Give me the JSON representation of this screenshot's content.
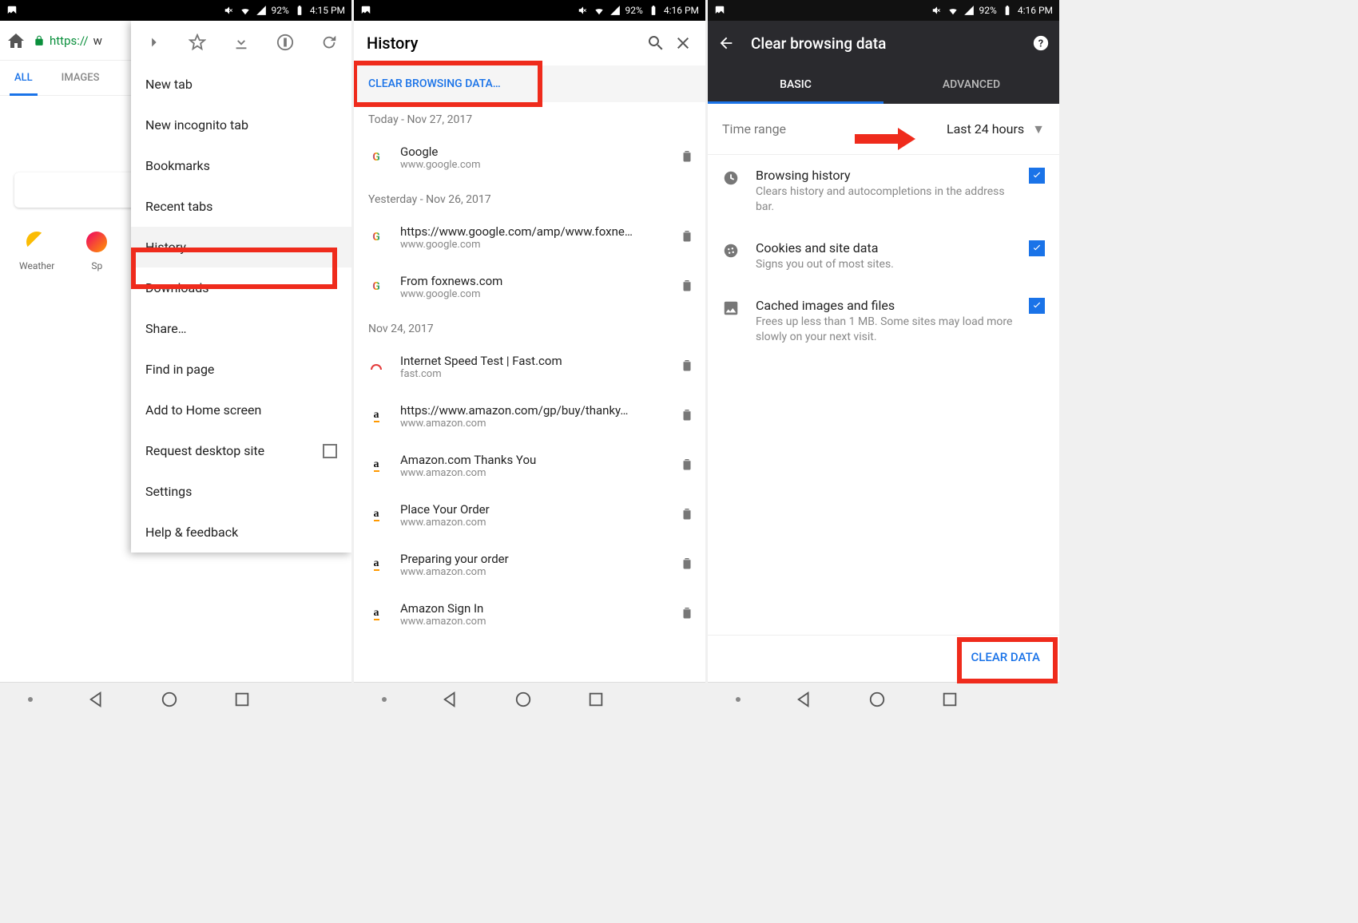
{
  "status": {
    "battery_text": "92%",
    "time1": "4:15 PM",
    "time2": "4:16 PM",
    "time3": "4:16 PM"
  },
  "screen1": {
    "url_prefix": "https://",
    "url_rest": "w",
    "tabs": {
      "all": "ALL",
      "images": "IMAGES"
    },
    "shortcut_weather": "Weather",
    "shortcut_sports": "Sp",
    "menu": {
      "new_tab": "New tab",
      "new_incognito": "New incognito tab",
      "bookmarks": "Bookmarks",
      "recent_tabs": "Recent tabs",
      "history": "History",
      "downloads": "Downloads",
      "share": "Share…",
      "find": "Find in page",
      "add_home": "Add to Home screen",
      "desktop": "Request desktop site",
      "settings": "Settings",
      "help": "Help & feedback"
    }
  },
  "screen2": {
    "title": "History",
    "clear_btn": "CLEAR BROWSING DATA…",
    "sections": [
      {
        "date": "Today - Nov 27, 2017",
        "entries": [
          {
            "title": "Google",
            "sub": "www.google.com",
            "fav": "G"
          }
        ]
      },
      {
        "date": "Yesterday - Nov 26, 2017",
        "entries": [
          {
            "title": "https://www.google.com/amp/www.foxne…",
            "sub": "www.google.com",
            "fav": "G"
          },
          {
            "title": "From foxnews.com",
            "sub": "www.google.com",
            "fav": "G"
          }
        ]
      },
      {
        "date": "Nov 24, 2017",
        "entries": [
          {
            "title": "Internet Speed Test | Fast.com",
            "sub": "fast.com",
            "fav": "speed"
          },
          {
            "title": "https://www.amazon.com/gp/buy/thanky…",
            "sub": "www.amazon.com",
            "fav": "a"
          },
          {
            "title": "Amazon.com Thanks You",
            "sub": "www.amazon.com",
            "fav": "a"
          },
          {
            "title": "Place Your Order",
            "sub": "www.amazon.com",
            "fav": "a"
          },
          {
            "title": "Preparing your order",
            "sub": "www.amazon.com",
            "fav": "a"
          },
          {
            "title": "Amazon Sign In",
            "sub": "www.amazon.com",
            "fav": "a"
          }
        ]
      }
    ]
  },
  "screen3": {
    "title": "Clear browsing data",
    "tabs": {
      "basic": "BASIC",
      "advanced": "ADVANCED"
    },
    "range": {
      "label": "Time range",
      "value": "Last 24 hours"
    },
    "opts": {
      "history": {
        "title": "Browsing history",
        "desc": "Clears history and autocompletions in the address bar."
      },
      "cookies": {
        "title": "Cookies and site data",
        "desc": "Signs you out of most sites."
      },
      "cache": {
        "title": "Cached images and files",
        "desc": "Frees up less than 1 MB. Some sites may load more slowly on your next visit."
      }
    },
    "clear_btn": "CLEAR DATA"
  }
}
